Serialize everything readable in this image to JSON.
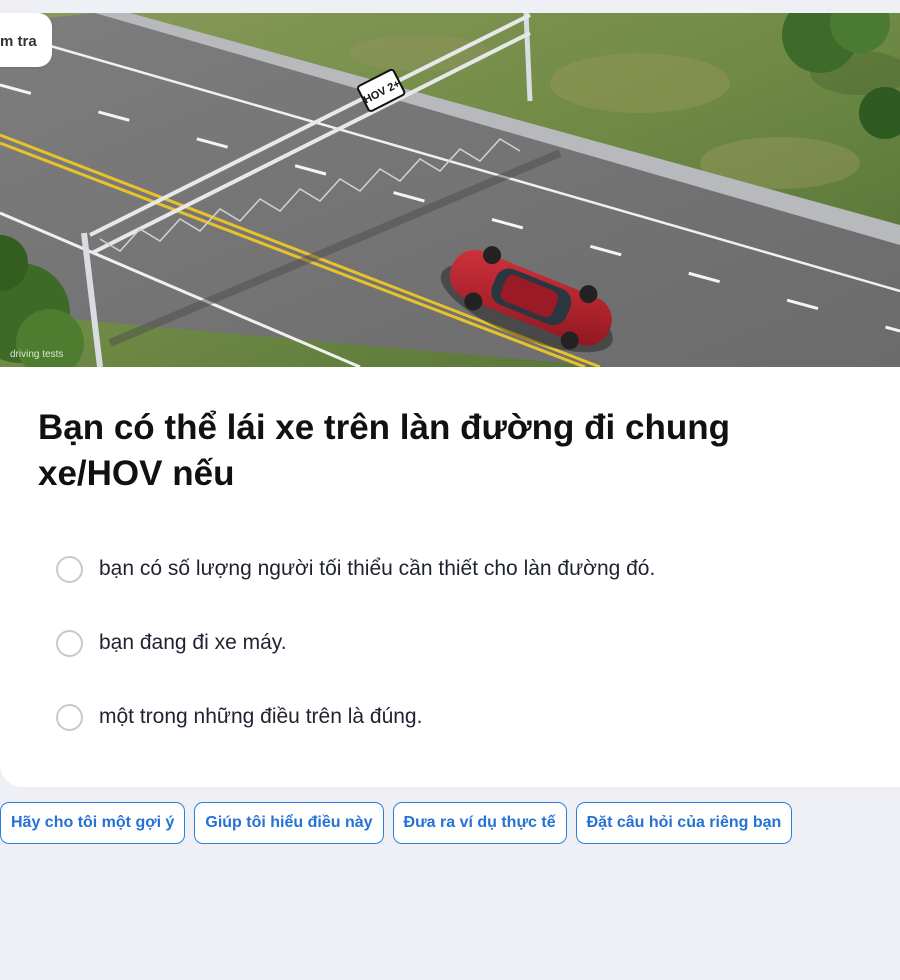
{
  "card": {
    "tab_pill_label": "m tra",
    "image": {
      "sign_text": "HOV 2+",
      "watermark": "driving tests"
    },
    "question": "Bạn có thể lái xe trên làn đường đi chung xe/HOV nếu",
    "options": [
      {
        "label": "bạn có số lượng người tối thiểu cần thiết cho làn đường đó.",
        "selected": false
      },
      {
        "label": "bạn đang đi xe máy.",
        "selected": false
      },
      {
        "label": "một trong những điều trên là đúng.",
        "selected": false
      }
    ]
  },
  "help_buttons": [
    "Hãy cho tôi một gợi ý",
    "Giúp tôi hiểu điều này",
    "Đưa ra ví dụ thực tế",
    "Đặt câu hỏi của riêng bạn"
  ],
  "colors": {
    "accent": "#2572d6",
    "background": "#eef0f5",
    "car": "#b3202c",
    "lane_yellow": "#e8c22a"
  }
}
